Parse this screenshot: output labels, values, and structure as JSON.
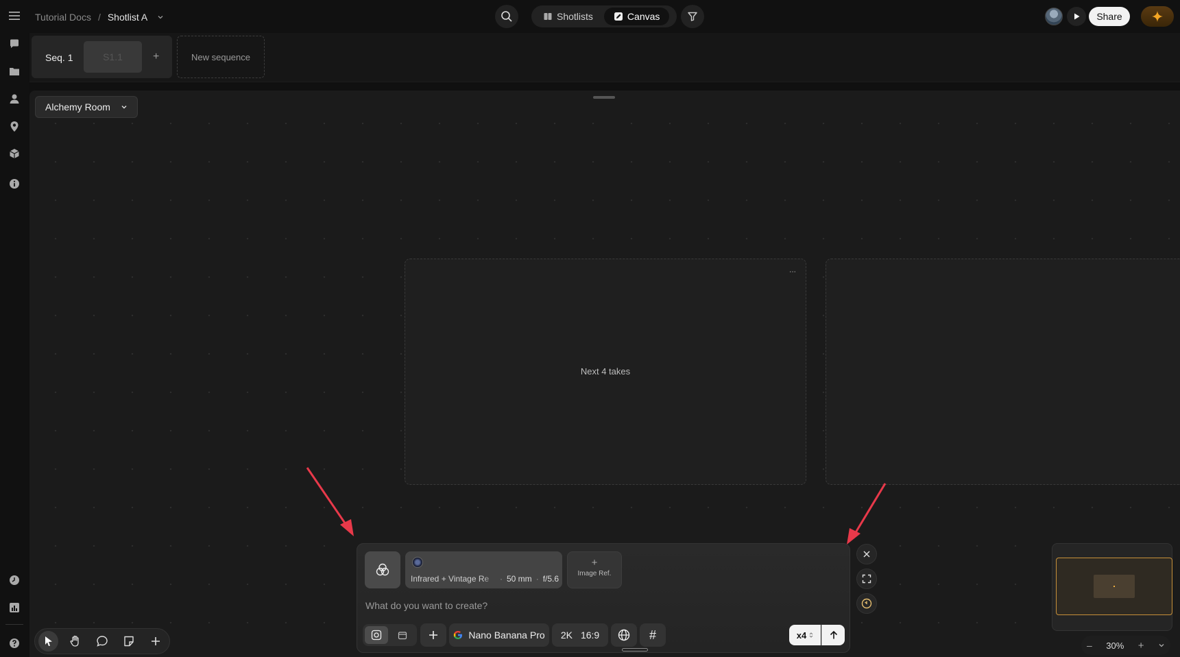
{
  "breadcrumb": {
    "root": "Tutorial Docs",
    "separator": "/",
    "current": "Shotlist A"
  },
  "view_switch": {
    "shotlists": "Shotlists",
    "canvas": "Canvas",
    "active": "Canvas"
  },
  "header": {
    "share_label": "Share"
  },
  "sequences": {
    "seq_label": "Seq. 1",
    "shot_label": "S1.1",
    "add_label": "+",
    "new_sequence_label": "New sequence"
  },
  "room": {
    "name": "Alchemy Room"
  },
  "canvas": {
    "frame_label": "Next 4 takes",
    "frame_menu": "..."
  },
  "composer": {
    "preset": {
      "name": "Infrared + Vintage Re",
      "lens": "50 mm",
      "aperture": "f/5.6",
      "separator": "·"
    },
    "image_ref_plus": "+",
    "image_ref_label": "Image Ref.",
    "placeholder": "What do you want to create?",
    "model": "Nano Banana Pro",
    "resolution": "2K",
    "aspect": "16:9",
    "hash": "#",
    "count": "x4"
  },
  "zoom": {
    "level": "30%",
    "minus": "–",
    "plus": "+"
  },
  "colors": {
    "accent_arrow": "#e8394a",
    "minimap_border": "#c8913a",
    "bg": "#101010"
  }
}
